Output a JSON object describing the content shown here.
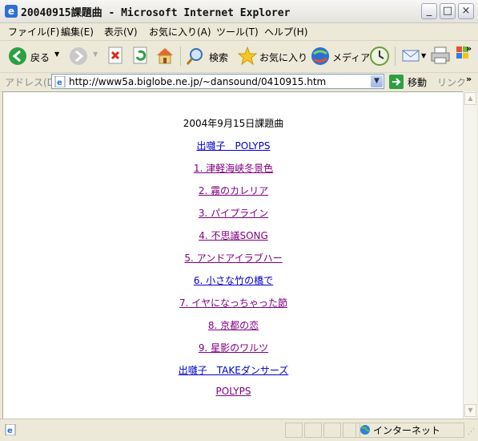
{
  "window": {
    "title": "20040915課題曲 - Microsoft Internet Explorer"
  },
  "menu": [
    "ファイル(F)",
    "編集(E)",
    "表示(V)",
    "お気に入り(A)",
    "ツール(T)",
    "ヘルプ(H)"
  ],
  "toolbar": {
    "back_label": "戻る",
    "search_label": "検索",
    "favorites_label": "お気に入り",
    "media_label": "メディア"
  },
  "address": {
    "label": "アドレス(D)",
    "url": "http://www5a.biglobe.ne.jp/~dansound/0410915.htm",
    "go_label": "移動",
    "links_label": "リンク"
  },
  "page": {
    "heading": "2004年9月15日課題曲",
    "links": [
      {
        "text": "出囃子　POLYPS",
        "visited": false
      },
      {
        "text": "1. 津軽海峡冬景色",
        "visited": true
      },
      {
        "text": "2. 霧のカレリア",
        "visited": true
      },
      {
        "text": "3. パイプライン",
        "visited": true
      },
      {
        "text": "4. 不思議SONG",
        "visited": true
      },
      {
        "text": "5. アンドアイラブハー",
        "visited": true
      },
      {
        "text": "6. 小さな竹の橋で",
        "visited": false
      },
      {
        "text": "7. イヤになっちゃった節",
        "visited": true
      },
      {
        "text": "8. 京都の恋",
        "visited": true
      },
      {
        "text": "9. 星影のワルツ",
        "visited": true
      },
      {
        "text": "出囃子　TAKEダンサーズ",
        "visited": false
      },
      {
        "text": "POLYPS",
        "visited": true
      }
    ]
  },
  "status": {
    "zone": "インターネット"
  },
  "colors": {
    "link": "#0000cc",
    "visited": "#800080"
  }
}
